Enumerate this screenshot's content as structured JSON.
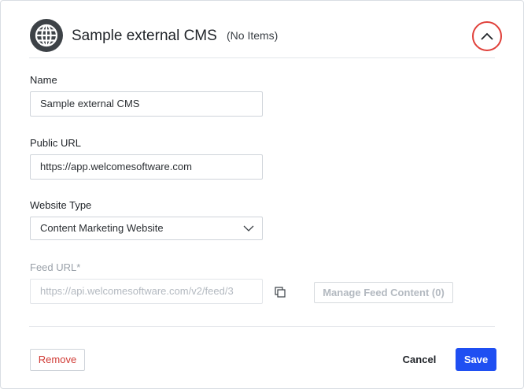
{
  "header": {
    "title": "Sample external CMS",
    "subtitle": "(No Items)",
    "icon": "globe-icon",
    "collapse_icon": "chevron-up-icon",
    "highlight_color": "#e0403a"
  },
  "form": {
    "name": {
      "label": "Name",
      "value": "Sample external CMS"
    },
    "public_url": {
      "label": "Public URL",
      "value": "https://app.welcomesoftware.com"
    },
    "website_type": {
      "label": "Website Type",
      "value": "Content Marketing Website"
    },
    "feed_url": {
      "label": "Feed URL*",
      "value": "https://api.welcomesoftware.com/v2/feed/3"
    },
    "manage_feed_label": "Manage Feed Content (0)"
  },
  "footer": {
    "remove_label": "Remove",
    "cancel_label": "Cancel",
    "save_label": "Save",
    "save_color": "#1f4ff2",
    "remove_color": "#d03a34"
  }
}
